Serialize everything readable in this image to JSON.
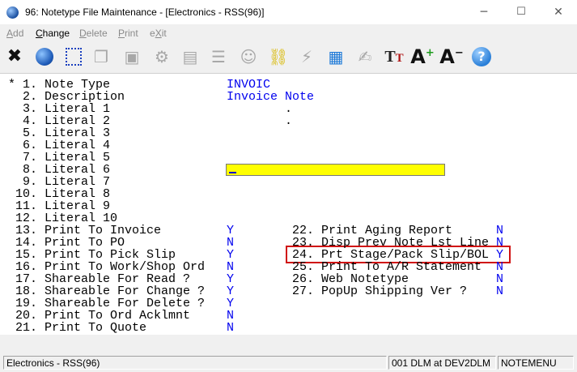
{
  "window": {
    "title": "96: Notetype File Maintenance - [Electronics - RSS(96)]",
    "minimize": "─",
    "maximize": "☐",
    "close": "✕"
  },
  "menu": [
    {
      "label": "Add",
      "enabled": false
    },
    {
      "label": "Change",
      "enabled": true
    },
    {
      "label": "Delete",
      "enabled": false
    },
    {
      "label": "Print",
      "enabled": false
    },
    {
      "label": "eXit",
      "enabled": false
    }
  ],
  "toolbar": [
    {
      "name": "exit-icon",
      "glyph": "✖",
      "color": "#111111"
    },
    {
      "name": "globe-icon",
      "glyph": "●",
      "color": "#1e5bb8"
    },
    {
      "name": "new-record-icon",
      "glyph": "⬚",
      "color": "#1a3fbf"
    },
    {
      "name": "copy-icon",
      "glyph": "❐",
      "color": "#a0a0a0"
    },
    {
      "name": "paste-icon",
      "glyph": "📋",
      "color": "#a0a0a0"
    },
    {
      "name": "settings-icon",
      "glyph": "⚙",
      "color": "#a0a0a0"
    },
    {
      "name": "edit-form-icon",
      "glyph": "▤",
      "color": "#a0a0a0"
    },
    {
      "name": "table-icon",
      "glyph": "☰",
      "color": "#a0a0a0"
    },
    {
      "name": "users-icon",
      "glyph": "☺",
      "color": "#a0a0a0"
    },
    {
      "name": "link-icon",
      "glyph": "⛓",
      "color": "#d8b800"
    },
    {
      "name": "lightning-icon",
      "glyph": "⚡",
      "color": "#a0a0a0"
    },
    {
      "name": "calculator-icon",
      "glyph": "▦",
      "color": "#1e7ad8"
    },
    {
      "name": "signature-icon",
      "glyph": "✍",
      "color": "#a0a0a0"
    },
    {
      "name": "font-icon",
      "glyph": "Tт",
      "color": "#b01818"
    },
    {
      "name": "font-increase-icon",
      "glyph": "A",
      "color": "#111111"
    },
    {
      "name": "font-decrease-icon",
      "glyph": "A",
      "color": "#111111"
    },
    {
      "name": "help-icon",
      "glyph": "?",
      "color": "#ffffff"
    }
  ],
  "form": {
    "required_marker": "*",
    "left_fields": [
      {
        "label": " 1. Note Type",
        "value": "INVOIC"
      },
      {
        "label": " 2. Description",
        "value": "Invoice Note"
      },
      {
        "label": " 3. Literal 1",
        "value": "."
      },
      {
        "label": " 4. Literal 2",
        "value": "."
      },
      {
        "label": " 5. Literal 3",
        "value": ""
      },
      {
        "label": " 6. Literal 4",
        "value": ""
      },
      {
        "label": " 7. Literal 5",
        "value": ""
      },
      {
        "label": " 8. Literal 6",
        "value": ""
      },
      {
        "label": " 9. Literal 7",
        "value": ""
      },
      {
        "label": "10. Literal 8",
        "value": ""
      },
      {
        "label": "11. Literal 9",
        "value": ""
      },
      {
        "label": "12. Literal 10",
        "value": ""
      },
      {
        "label": "13. Print To Invoice",
        "value": "Y"
      },
      {
        "label": "14. Print To PO",
        "value": "N"
      },
      {
        "label": "15. Print To Pick Slip",
        "value": "Y"
      },
      {
        "label": "16. Print To Work/Shop Ord",
        "value": "N"
      },
      {
        "label": "17. Shareable For Read ?",
        "value": "Y"
      },
      {
        "label": "18. Shareable For Change ?",
        "value": "Y"
      },
      {
        "label": "19. Shareable For Delete ?",
        "value": "Y"
      },
      {
        "label": "20. Print To Ord Acklmnt",
        "value": "N"
      },
      {
        "label": "21. Print To Quote",
        "value": "N"
      }
    ],
    "right_fields": [
      {
        "label": "22. Print Aging Report",
        "value": "N"
      },
      {
        "label": "23. Disp Prev Note Lst Line",
        "value": "N"
      },
      {
        "label": "24. Prt Stage/Pack Slip/BOL",
        "value": "Y"
      },
      {
        "label": "25. Print To A/R Statement",
        "value": "N"
      },
      {
        "label": "26. Web Notetype",
        "value": "N"
      },
      {
        "label": "27. PopUp Shipping Ver ?",
        "value": "N"
      }
    ]
  },
  "status": {
    "company": "Electronics - RSS(96)",
    "session": "001 DLM at DEV2DLM",
    "screen": "NOTEMENU"
  },
  "colors": {
    "value_text": "#0000ee",
    "active_input": "#ffff00",
    "highlight_box": "#d01010"
  }
}
